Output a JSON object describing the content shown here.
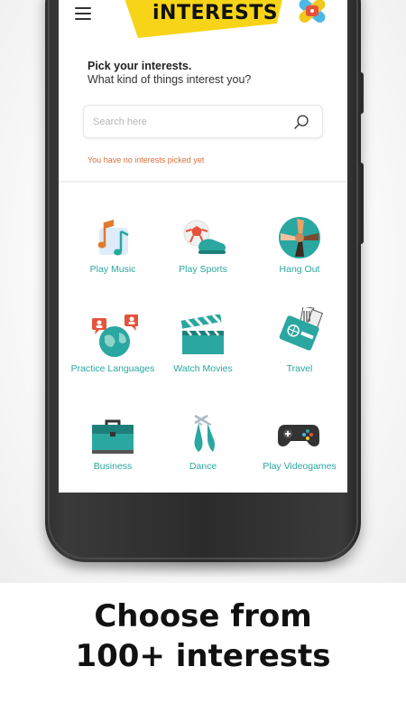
{
  "app": {
    "title": "iNTERESTS",
    "prompt_title": "Pick your interests.",
    "prompt_subtitle": "What kind of things interest you?"
  },
  "search": {
    "placeholder": "Search here",
    "value": ""
  },
  "empty_message": "You have no interests picked yet",
  "interests": [
    {
      "label": "Play Music",
      "icon": "music-notes-icon"
    },
    {
      "label": "Play Sports",
      "icon": "sports-ball-shoe-icon"
    },
    {
      "label": "Hang Out",
      "icon": "hands-together-icon"
    },
    {
      "label": "Practice Languages",
      "icon": "globe-chat-icon"
    },
    {
      "label": "Watch Movies",
      "icon": "clapperboard-icon"
    },
    {
      "label": "Travel",
      "icon": "passport-tickets-icon"
    },
    {
      "label": "Business",
      "icon": "briefcase-icon"
    },
    {
      "label": "Dance",
      "icon": "ballet-shoes-icon"
    },
    {
      "label": "Play Videogames",
      "icon": "gamepad-icon"
    }
  ],
  "caption": {
    "line1": "Choose from",
    "line2": "100+ interests"
  },
  "colors": {
    "accent_teal": "#2aa7a0",
    "banner_yellow": "#f7d417",
    "empty_note_orange": "#d4703a"
  }
}
